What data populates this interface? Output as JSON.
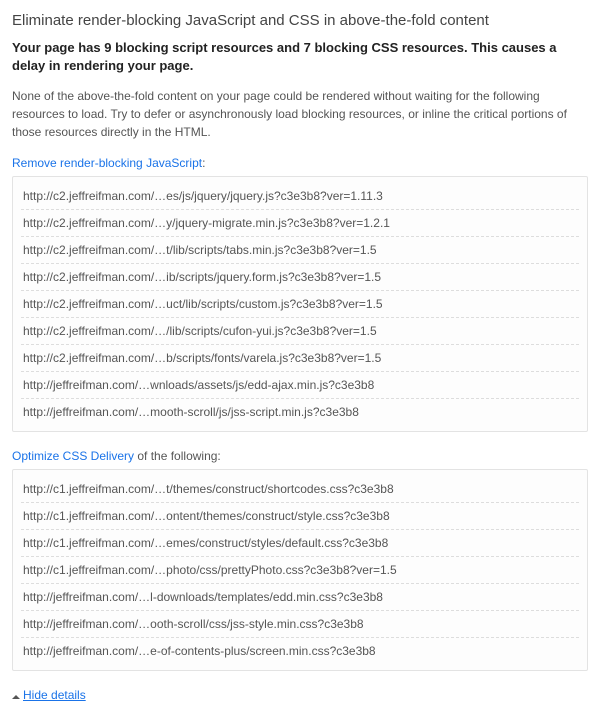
{
  "title": "Eliminate render-blocking JavaScript and CSS in above-the-fold content",
  "summary": "Your page has 9 blocking script resources and 7 blocking CSS resources. This causes a delay in rendering your page.",
  "description": "None of the above-the-fold content on your page could be rendered without waiting for the following resources to load. Try to defer or asynchronously load blocking resources, or inline the critical portions of those resources directly in the HTML.",
  "js_section": {
    "link_text": "Remove render-blocking JavaScript",
    "suffix": ":",
    "items": [
      "http://c2.jeffreifman.com/…es/js/jquery/jquery.js?c3e3b8?ver=1.11.3",
      "http://c2.jeffreifman.com/…y/jquery-migrate.min.js?c3e3b8?ver=1.2.1",
      "http://c2.jeffreifman.com/…t/lib/scripts/tabs.min.js?c3e3b8?ver=1.5",
      "http://c2.jeffreifman.com/…ib/scripts/jquery.form.js?c3e3b8?ver=1.5",
      "http://c2.jeffreifman.com/…uct/lib/scripts/custom.js?c3e3b8?ver=1.5",
      "http://c2.jeffreifman.com/…/lib/scripts/cufon-yui.js?c3e3b8?ver=1.5",
      "http://c2.jeffreifman.com/…b/scripts/fonts/varela.js?c3e3b8?ver=1.5",
      "http://jeffreifman.com/…wnloads/assets/js/edd-ajax.min.js?c3e3b8",
      "http://jeffreifman.com/…mooth-scroll/js/jss-script.min.js?c3e3b8"
    ]
  },
  "css_section": {
    "link_text": "Optimize CSS Delivery",
    "suffix": " of the following:",
    "items": [
      "http://c1.jeffreifman.com/…t/themes/construct/shortcodes.css?c3e3b8",
      "http://c1.jeffreifman.com/…ontent/themes/construct/style.css?c3e3b8",
      "http://c1.jeffreifman.com/…emes/construct/styles/default.css?c3e3b8",
      "http://c1.jeffreifman.com/…photo/css/prettyPhoto.css?c3e3b8?ver=1.5",
      "http://jeffreifman.com/…l-downloads/templates/edd.min.css?c3e3b8",
      "http://jeffreifman.com/…ooth-scroll/css/jss-style.min.css?c3e3b8",
      "http://jeffreifman.com/…e-of-contents-plus/screen.min.css?c3e3b8"
    ]
  },
  "hide_details": "Hide details"
}
